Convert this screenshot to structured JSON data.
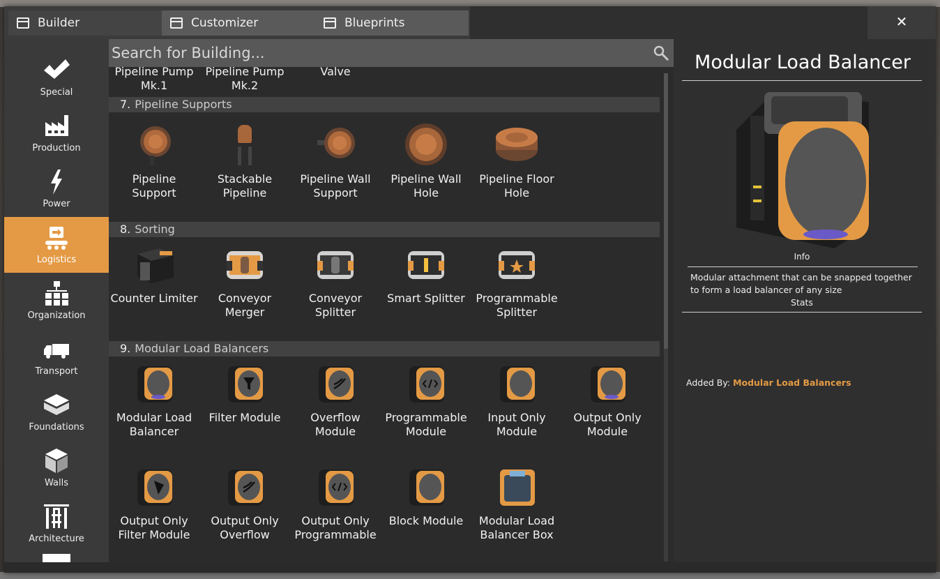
{
  "tabs": [
    {
      "label": "Builder",
      "active": true
    },
    {
      "label": "Customizer",
      "active": false
    },
    {
      "label": "Blueprints",
      "active": false
    }
  ],
  "close_icon": "close-icon",
  "categories": [
    {
      "label": "Special",
      "icon": "checkmark-icon"
    },
    {
      "label": "Production",
      "icon": "factory-icon"
    },
    {
      "label": "Power",
      "icon": "lightning-icon"
    },
    {
      "label": "Logistics",
      "icon": "conveyor-icon",
      "active": true
    },
    {
      "label": "Organization",
      "icon": "hierarchy-icon"
    },
    {
      "label": "Transport",
      "icon": "truck-icon"
    },
    {
      "label": "Foundations",
      "icon": "foundation-icon"
    },
    {
      "label": "Walls",
      "icon": "wall-icon"
    },
    {
      "label": "Architecture",
      "icon": "architecture-icon"
    }
  ],
  "search": {
    "placeholder": "Search for Building...",
    "icon": "search-icon"
  },
  "partial_items": [
    "Pipeline Pump Mk.1",
    "Pipeline Pump Mk.2",
    "Valve"
  ],
  "sections": [
    {
      "num": "7.",
      "title": "Pipeline Supports",
      "items": [
        "Pipeline Support",
        "Stackable Pipeline",
        "Pipeline Wall Support",
        "Pipeline Wall Hole",
        "Pipeline Floor Hole"
      ]
    },
    {
      "num": "8.",
      "title": "Sorting",
      "items": [
        "Counter Limiter",
        "Conveyor Merger",
        "Conveyor Splitter",
        "Smart Splitter",
        "Programmable Splitter"
      ]
    },
    {
      "num": "9.",
      "title": "Modular Load Balancers",
      "items": [
        "Modular Load Balancer",
        "Filter Module",
        "Overflow Module",
        "Programmable Module",
        "Input Only Module",
        "Output Only Module",
        "Output Only Filter Module",
        "Output Only Overflow",
        "Output Only Programmable",
        "Block Module",
        "Modular Load Balancer Box"
      ]
    }
  ],
  "detail": {
    "title": "Modular Load Balancer",
    "info_label": "Info",
    "description": "Modular attachment that can be snapped together to form a load balancer of any size",
    "stats_label": "Stats",
    "added_by_label": "Added By:",
    "added_by_mod": "Modular Load Balancers"
  },
  "colors": {
    "accent": "#e49a45",
    "panel": "#2c2c2c",
    "sidebar": "#3a3a3a"
  }
}
